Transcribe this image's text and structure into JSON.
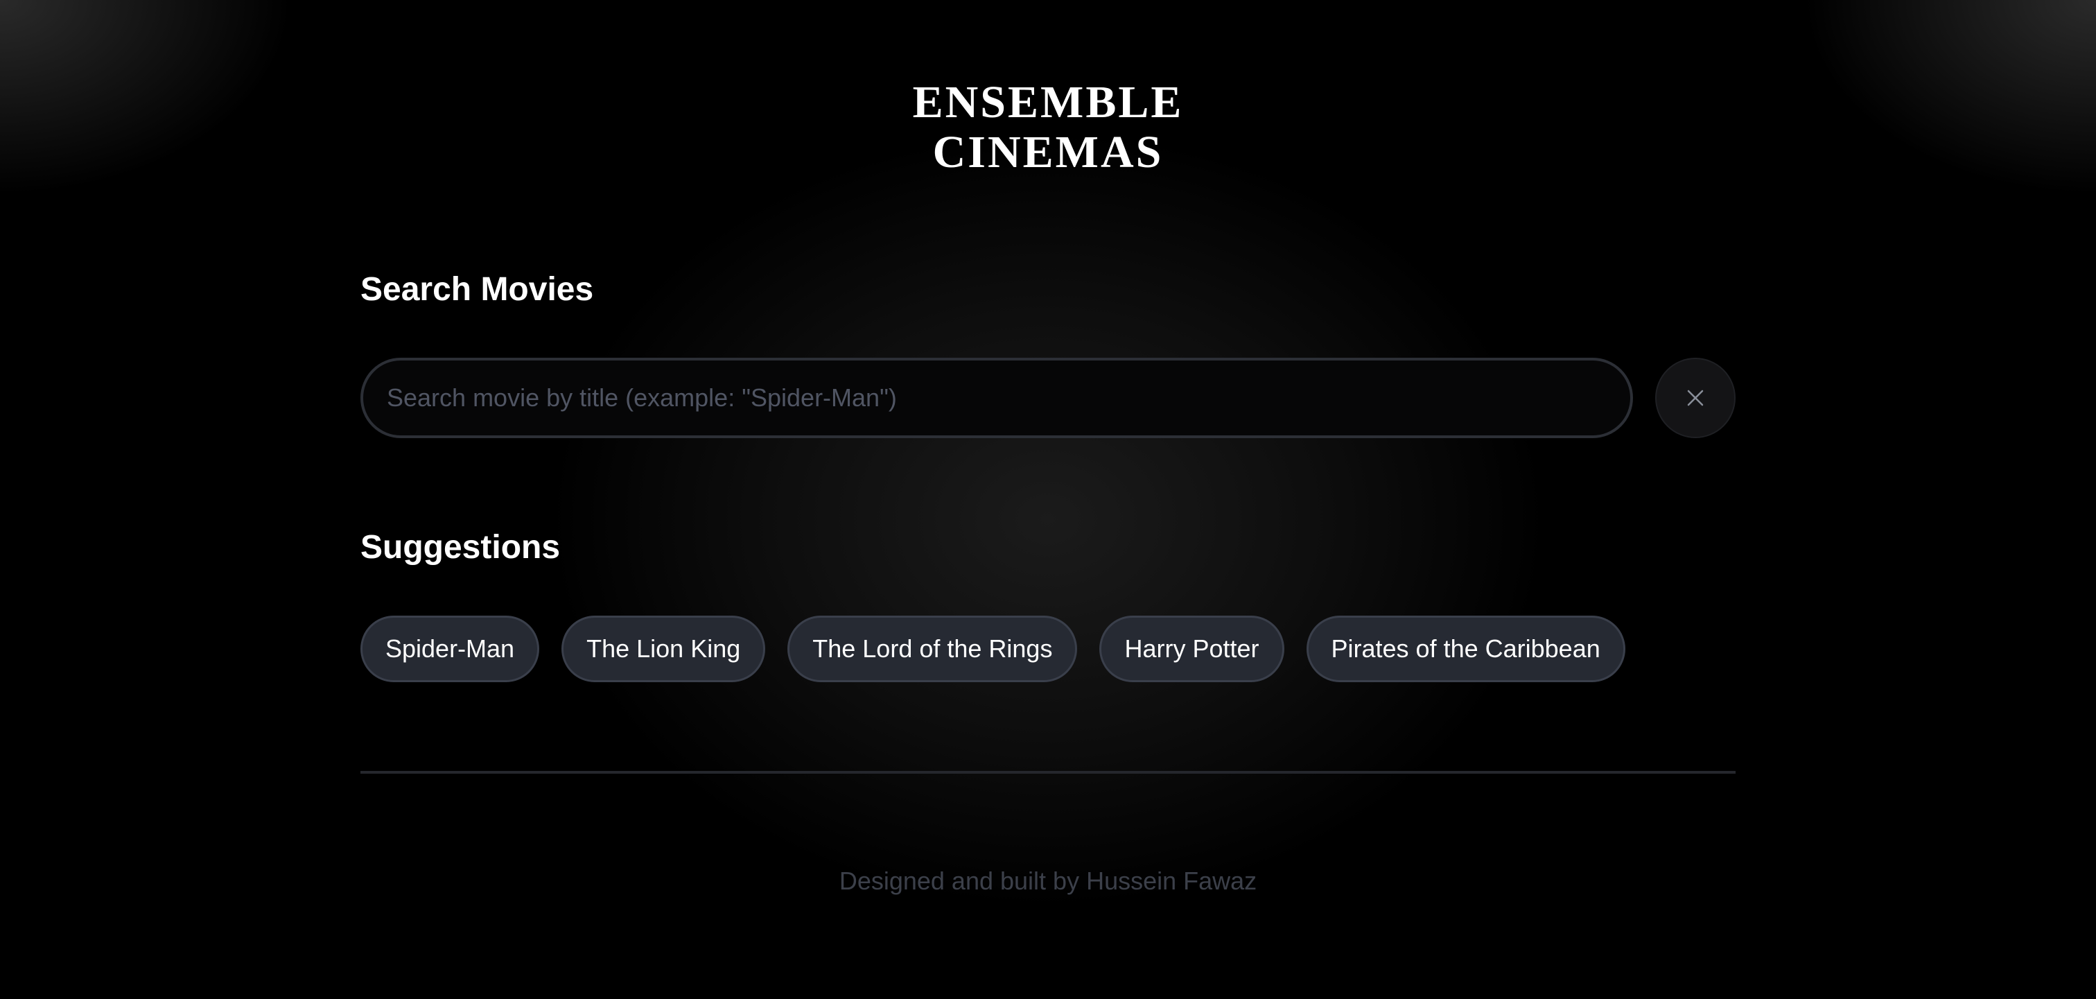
{
  "brand": {
    "line1": "ENSEMBLE",
    "line2": "CINEMAS"
  },
  "search": {
    "heading": "Search Movies",
    "placeholder": "Search movie by title (example: \"Spider-Man\")",
    "value": "",
    "clear_icon": "close-icon"
  },
  "suggestions": {
    "heading": "Suggestions",
    "items": [
      "Spider-Man",
      "The Lion King",
      "The Lord of the Rings",
      "Harry Potter",
      "Pirates of the Caribbean"
    ]
  },
  "footer": {
    "text": "Designed and built by Hussein Fawaz"
  },
  "colors": {
    "background": "#000000",
    "chip_bg": "#262a33",
    "chip_border": "#3a3f4b",
    "input_border": "#2c2f36",
    "footer_text": "#3c404a"
  }
}
